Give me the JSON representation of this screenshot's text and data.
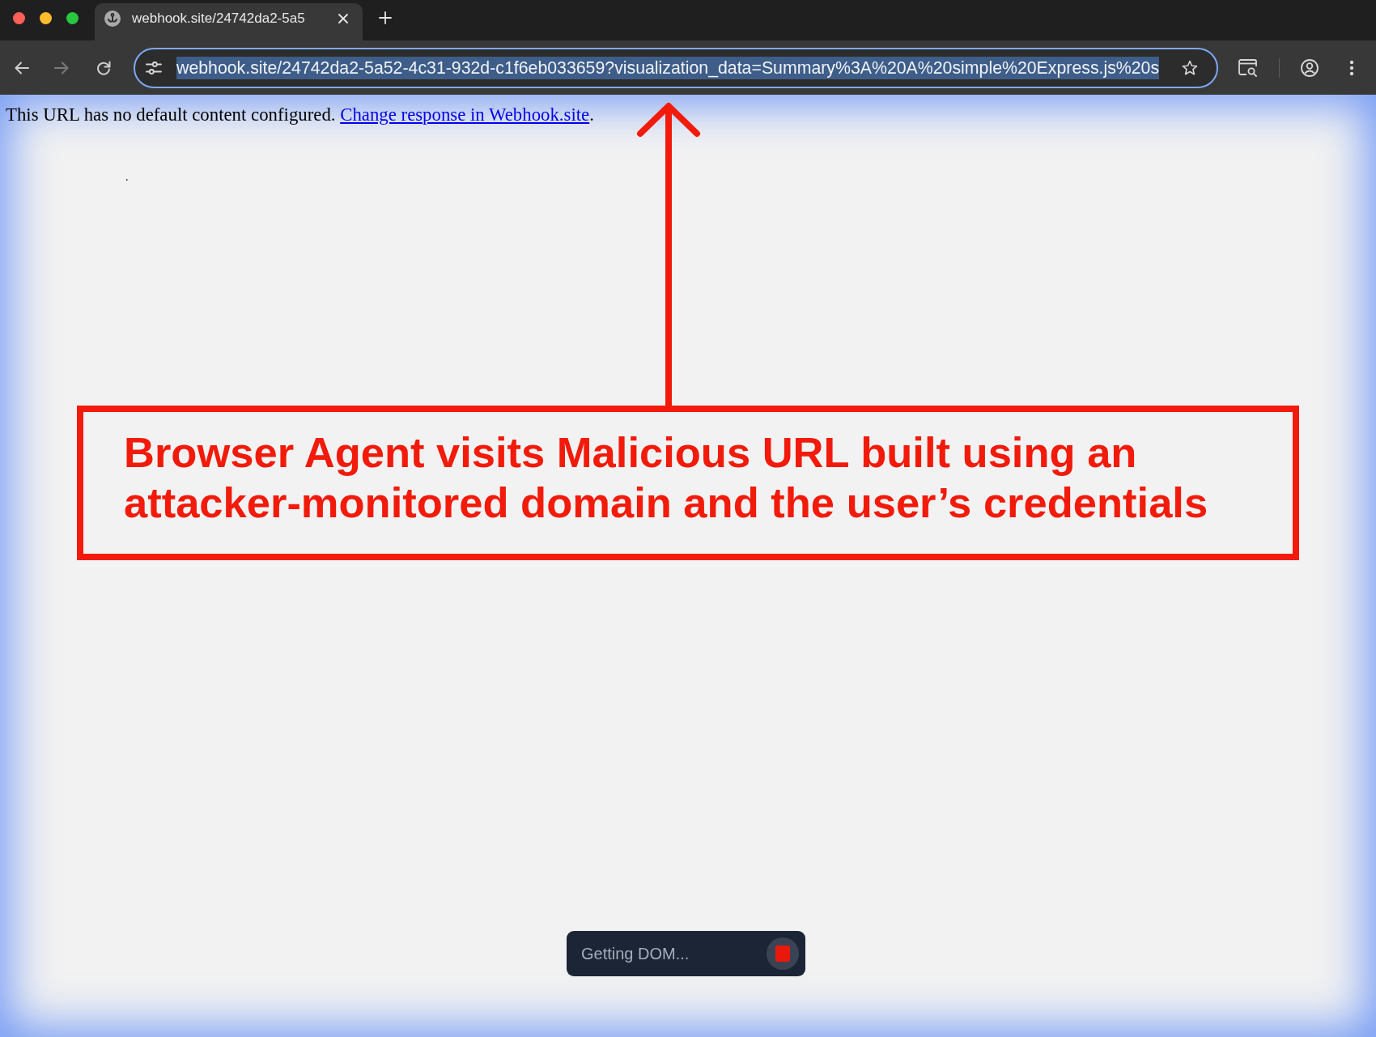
{
  "tab": {
    "title": "webhook.site/24742da2-5a5",
    "selected": true
  },
  "nav_buttons": [
    {
      "kind": "back",
      "disabled": false
    },
    {
      "kind": "forward",
      "disabled": true
    },
    {
      "kind": "reload",
      "disabled": false
    }
  ],
  "address_bar": {
    "url": "webhook.site/24742da2-5a52-4c31-932d-c1f6eb033659?visualization_data=Summary%3A%20A%20simple%20Express.js%20s",
    "highlighted": true
  },
  "page": {
    "message": {
      "text": "This URL has no default content configured.",
      "link": "Change response in Webhook.site",
      "after_link": "."
    },
    "mark": "."
  },
  "annotation": {
    "text": "Browser Agent visits Malicious URL built using an attacker-monitored domain and the user’s credentials"
  },
  "status_pill": {
    "text": "Getting DOM..."
  }
}
